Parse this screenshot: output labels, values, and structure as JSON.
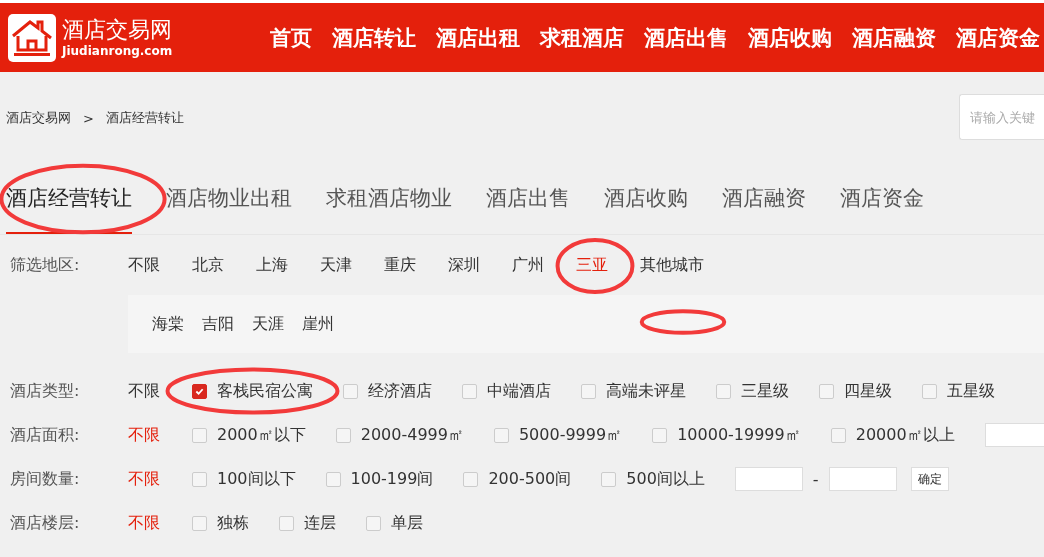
{
  "header": {
    "site_name": "酒店交易网",
    "domain": "Jiudianrong.com",
    "nav": [
      "首页",
      "酒店转让",
      "酒店出租",
      "求租酒店",
      "酒店出售",
      "酒店收购",
      "酒店融资",
      "酒店资金"
    ]
  },
  "breadcrumb": [
    "酒店交易网",
    ">",
    "酒店经营转让"
  ],
  "search": {
    "placeholder": "请输入关键"
  },
  "tabs": [
    {
      "label": "酒店经营转让",
      "selected": true,
      "circled": true
    },
    {
      "label": "酒店物业出租",
      "selected": false
    },
    {
      "label": "求租酒店物业",
      "selected": false
    },
    {
      "label": "酒店出售",
      "selected": false
    },
    {
      "label": "酒店收购",
      "selected": false
    },
    {
      "label": "酒店融资",
      "selected": false
    },
    {
      "label": "酒店资金",
      "selected": false
    }
  ],
  "region_filter": {
    "label": "筛选地区:",
    "options": [
      {
        "label": "不限",
        "selected": false
      },
      {
        "label": "北京",
        "selected": false
      },
      {
        "label": "上海",
        "selected": false
      },
      {
        "label": "天津",
        "selected": false
      },
      {
        "label": "重庆",
        "selected": false
      },
      {
        "label": "深圳",
        "selected": false
      },
      {
        "label": "广州",
        "selected": false
      },
      {
        "label": "三亚",
        "selected": true,
        "circled": true
      },
      {
        "label": "其他城市",
        "selected": false
      }
    ],
    "sub_areas": [
      {
        "label": "海棠"
      },
      {
        "label": "吉阳"
      },
      {
        "label": "天涯"
      },
      {
        "label": "崖州"
      }
    ],
    "sub_area_mark": true
  },
  "filters": [
    {
      "label": "酒店类型:",
      "any": {
        "label": "不限",
        "selected": false
      },
      "options": [
        {
          "label": "客栈民宿公寓",
          "checked": true,
          "circled": true
        },
        {
          "label": "经济酒店",
          "checked": false
        },
        {
          "label": "中端酒店",
          "checked": false
        },
        {
          "label": "高端未评星",
          "checked": false
        },
        {
          "label": "三星级",
          "checked": false
        },
        {
          "label": "四星级",
          "checked": false
        },
        {
          "label": "五星级",
          "checked": false
        }
      ]
    },
    {
      "label": "酒店面积:",
      "any": {
        "label": "不限",
        "selected": true
      },
      "options": [
        {
          "label": "2000㎡以下",
          "checked": false
        },
        {
          "label": "2000-4999㎡",
          "checked": false
        },
        {
          "label": "5000-9999㎡",
          "checked": false
        },
        {
          "label": "10000-19999㎡",
          "checked": false
        },
        {
          "label": "20000㎡以上",
          "checked": false
        }
      ],
      "range": {
        "kind": "partial"
      }
    },
    {
      "label": "房间数量:",
      "any": {
        "label": "不限",
        "selected": true
      },
      "options": [
        {
          "label": "100间以下",
          "checked": false
        },
        {
          "label": "100-199间",
          "checked": false
        },
        {
          "label": "200-500间",
          "checked": false
        },
        {
          "label": "500间以上",
          "checked": false
        }
      ],
      "range": {
        "kind": "full",
        "separator": "-",
        "button": "确定"
      }
    },
    {
      "label": "酒店楼层:",
      "any": {
        "label": "不限",
        "selected": true
      },
      "options": [
        {
          "label": "独栋",
          "checked": false
        },
        {
          "label": "连层",
          "checked": false
        },
        {
          "label": "单层",
          "checked": false
        }
      ]
    }
  ]
}
